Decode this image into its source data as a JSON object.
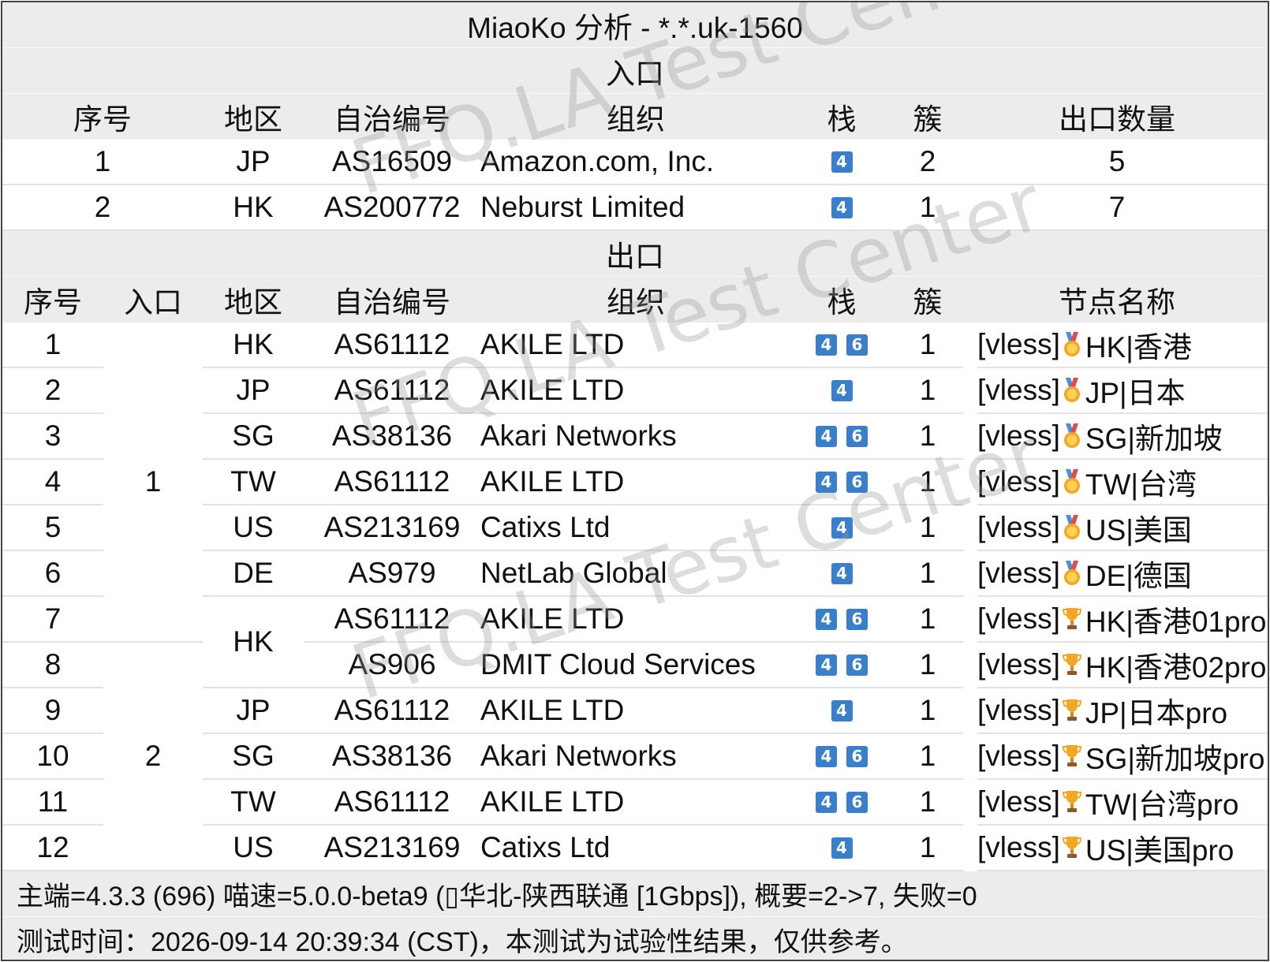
{
  "title": "MiaoKo 分析 - *.*.uk-1560",
  "watermark": "FFQ.LA Test Center",
  "colors": {
    "header_bg": "#ececec",
    "badge_blue": "#3a7fcc",
    "gold_medal": "#f5a623"
  },
  "inbound": {
    "section_title": "入口",
    "headers": {
      "index": "序号",
      "region": "地区",
      "asn": "自治编号",
      "org": "组织",
      "stack": "栈",
      "cluster": "簇",
      "exits": "出口数量"
    },
    "rows": [
      {
        "index": "1",
        "region": "JP",
        "asn": "AS16509",
        "org": "Amazon.com, Inc.",
        "stack": [
          "4"
        ],
        "cluster": "2",
        "exits": "5"
      },
      {
        "index": "2",
        "region": "HK",
        "asn": "AS200772",
        "org": "Neburst Limited",
        "stack": [
          "4"
        ],
        "cluster": "1",
        "exits": "7"
      }
    ]
  },
  "outbound": {
    "section_title": "出口",
    "headers": {
      "index": "序号",
      "entry": "入口",
      "region": "地区",
      "asn": "自治编号",
      "org": "组织",
      "stack": "栈",
      "cluster": "簇",
      "node": "节点名称"
    },
    "entry_groups": [
      "1",
      "2"
    ],
    "hk_merged_region": "HK",
    "rows": [
      {
        "index": "1",
        "region": "HK",
        "asn": "AS61112",
        "org": "AKILE LTD",
        "stack": [
          "4",
          "6"
        ],
        "cluster": "1",
        "node_prefix": "[vless]",
        "medal": "gold-medal-icon",
        "node_name": "HK|香港"
      },
      {
        "index": "2",
        "region": "JP",
        "asn": "AS61112",
        "org": "AKILE LTD",
        "stack": [
          "4"
        ],
        "cluster": "1",
        "node_prefix": "[vless]",
        "medal": "gold-medal-icon",
        "node_name": "JP|日本"
      },
      {
        "index": "3",
        "region": "SG",
        "asn": "AS38136",
        "org": "Akari Networks",
        "stack": [
          "4",
          "6"
        ],
        "cluster": "1",
        "node_prefix": "[vless]",
        "medal": "gold-medal-icon",
        "node_name": "SG|新加坡"
      },
      {
        "index": "4",
        "region": "TW",
        "asn": "AS61112",
        "org": "AKILE LTD",
        "stack": [
          "4",
          "6"
        ],
        "cluster": "1",
        "node_prefix": "[vless]",
        "medal": "gold-medal-icon",
        "node_name": "TW|台湾"
      },
      {
        "index": "5",
        "region": "US",
        "asn": "AS213169",
        "org": "Catixs Ltd",
        "stack": [
          "4"
        ],
        "cluster": "1",
        "node_prefix": "[vless]",
        "medal": "gold-medal-icon",
        "node_name": "US|美国"
      },
      {
        "index": "6",
        "region": "DE",
        "asn": "AS979",
        "org": "NetLab Global",
        "stack": [
          "4"
        ],
        "cluster": "1",
        "node_prefix": "[vless]",
        "medal": "gold-medal-icon",
        "node_name": "DE|德国"
      },
      {
        "index": "7",
        "region": "",
        "asn": "AS61112",
        "org": "AKILE LTD",
        "stack": [
          "4",
          "6"
        ],
        "cluster": "1",
        "node_prefix": "[vless]",
        "medal": "trophy-icon",
        "node_name": "HK|香港01pro"
      },
      {
        "index": "8",
        "region": "",
        "asn": "AS906",
        "org": "DMIT Cloud Services",
        "stack": [
          "4",
          "6"
        ],
        "cluster": "1",
        "node_prefix": "[vless]",
        "medal": "trophy-icon",
        "node_name": "HK|香港02pro"
      },
      {
        "index": "9",
        "region": "JP",
        "asn": "AS61112",
        "org": "AKILE LTD",
        "stack": [
          "4"
        ],
        "cluster": "1",
        "node_prefix": "[vless]",
        "medal": "trophy-icon",
        "node_name": "JP|日本pro"
      },
      {
        "index": "10",
        "region": "SG",
        "asn": "AS38136",
        "org": "Akari Networks",
        "stack": [
          "4",
          "6"
        ],
        "cluster": "1",
        "node_prefix": "[vless]",
        "medal": "trophy-icon",
        "node_name": "SG|新加坡pro"
      },
      {
        "index": "11",
        "region": "TW",
        "asn": "AS61112",
        "org": "AKILE LTD",
        "stack": [
          "4",
          "6"
        ],
        "cluster": "1",
        "node_prefix": "[vless]",
        "medal": "trophy-icon",
        "node_name": "TW|台湾pro"
      },
      {
        "index": "12",
        "region": "US",
        "asn": "AS213169",
        "org": "Catixs Ltd",
        "stack": [
          "4"
        ],
        "cluster": "1",
        "node_prefix": "[vless]",
        "medal": "trophy-icon",
        "node_name": "US|美国pro"
      }
    ]
  },
  "footer": {
    "line1": "主端=4.3.3 (696) 喵速=5.0.0-beta9 (▯华北-陕西联通 [1Gbps]), 概要=2->7, 失败=0",
    "line2": "测试时间：2026-09-14 20:39:34 (CST)，本测试为试验性结果，仅供参考。"
  }
}
